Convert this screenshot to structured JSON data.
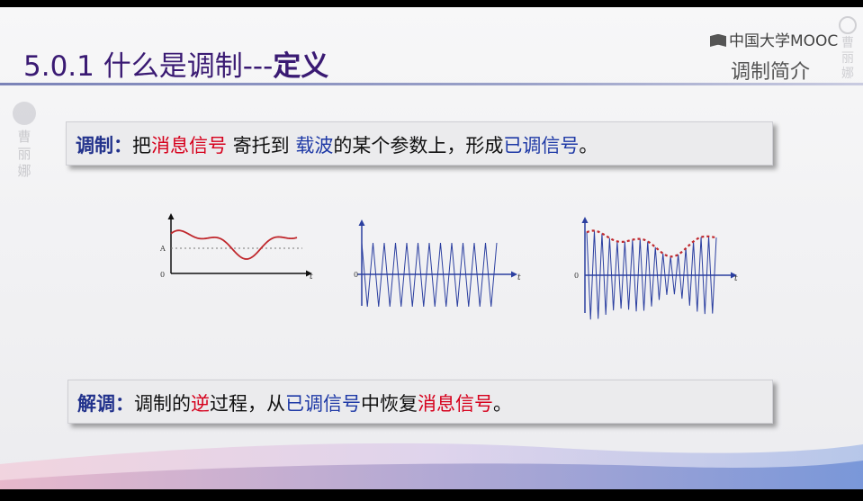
{
  "header": {
    "section_number": "5.0.1",
    "title_main": "什么是调制---",
    "title_bold": "定义",
    "brand": "中国大学MOOC",
    "subtitle": "调制简介"
  },
  "watermark": {
    "name": "曹丽娜"
  },
  "definition": {
    "term": "调制：",
    "p1": "把",
    "msg": "消息信号",
    "p2": "寄托到",
    "carrier": "载波",
    "p3": "的某个参数上，形成",
    "modulated": "已调信号",
    "p4": "。"
  },
  "demodulation": {
    "term": "解调：",
    "p1": "调制的",
    "inverse": "逆",
    "p2": "过程，从",
    "modulated": "已调信号",
    "p3": "中恢复",
    "msg": "消息信号",
    "p4": "。"
  },
  "plots": {
    "message": {
      "origin_label": "0",
      "level_label": "A",
      "axis_label": "t"
    },
    "carrier": {
      "origin_label": "0",
      "axis_label": "t"
    },
    "modulated": {
      "origin_label": "0",
      "axis_label": "t"
    }
  },
  "colors": {
    "title": "#3a1a73",
    "keyword": "#22328c",
    "highlight_red": "#d6001c",
    "highlight_blue": "#1e39a6",
    "message_curve": "#c0282d",
    "carrier_curve": "#2b3fa0"
  }
}
